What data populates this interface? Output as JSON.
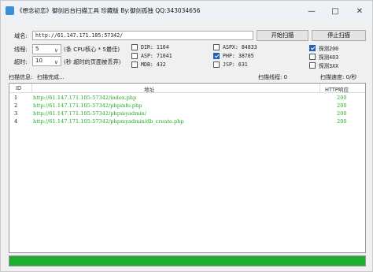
{
  "window": {
    "title": "《想念初恋》御剑后台扫描工具 珍藏版 By:御剑孤独 QQ:343034656",
    "minimize_icon": "minimize-icon",
    "maximize_icon": "maximize-icon",
    "close_icon": "close-icon"
  },
  "domain": {
    "label": "域名:",
    "value": "http://61.147.171.105:57342/"
  },
  "threads": {
    "label": "线程:",
    "value": "5",
    "hint": "(条 CPU核心 * 5最佳)"
  },
  "timeout": {
    "label": "超时:",
    "value": "10",
    "hint": "(秒 超时的页面被丢弃)"
  },
  "buttons": {
    "start": "开始扫描",
    "stop": "停止扫描"
  },
  "checkboxes": [
    {
      "label": "DIR: 1164",
      "checked": false
    },
    {
      "label": "ASP: 71041",
      "checked": false
    },
    {
      "label": "MDB: 432",
      "checked": false
    },
    {
      "label": "ASPX: 84833",
      "checked": false
    },
    {
      "label": "PHP: 38705",
      "checked": true
    },
    {
      "label": "JSP: 631",
      "checked": false
    },
    {
      "label": "探测200",
      "checked": true
    },
    {
      "label": "探测403",
      "checked": false
    },
    {
      "label": "探测3XX",
      "checked": false
    }
  ],
  "status": {
    "info_label": "扫描信息:",
    "info_value": "扫描完成...",
    "threads_text": "扫描线程: 0",
    "speed_text": "扫描速度: 0/秒"
  },
  "table": {
    "headers": {
      "id": "ID",
      "url": "地址",
      "code": "HTTP响应"
    },
    "rows": [
      {
        "id": "1",
        "url": "http://61.147.171.105:57342/index.php",
        "code": "200"
      },
      {
        "id": "2",
        "url": "http://61.147.171.105:57342/phpinfo.php",
        "code": "200"
      },
      {
        "id": "3",
        "url": "http://61.147.171.105:57342/phpmyadmin/",
        "code": "200"
      },
      {
        "id": "4",
        "url": "http://61.147.171.105:57342/phpmyadmin/db_create.php",
        "code": "200"
      }
    ]
  },
  "progress": {
    "value": 1.0,
    "color": "#1fad2f"
  }
}
